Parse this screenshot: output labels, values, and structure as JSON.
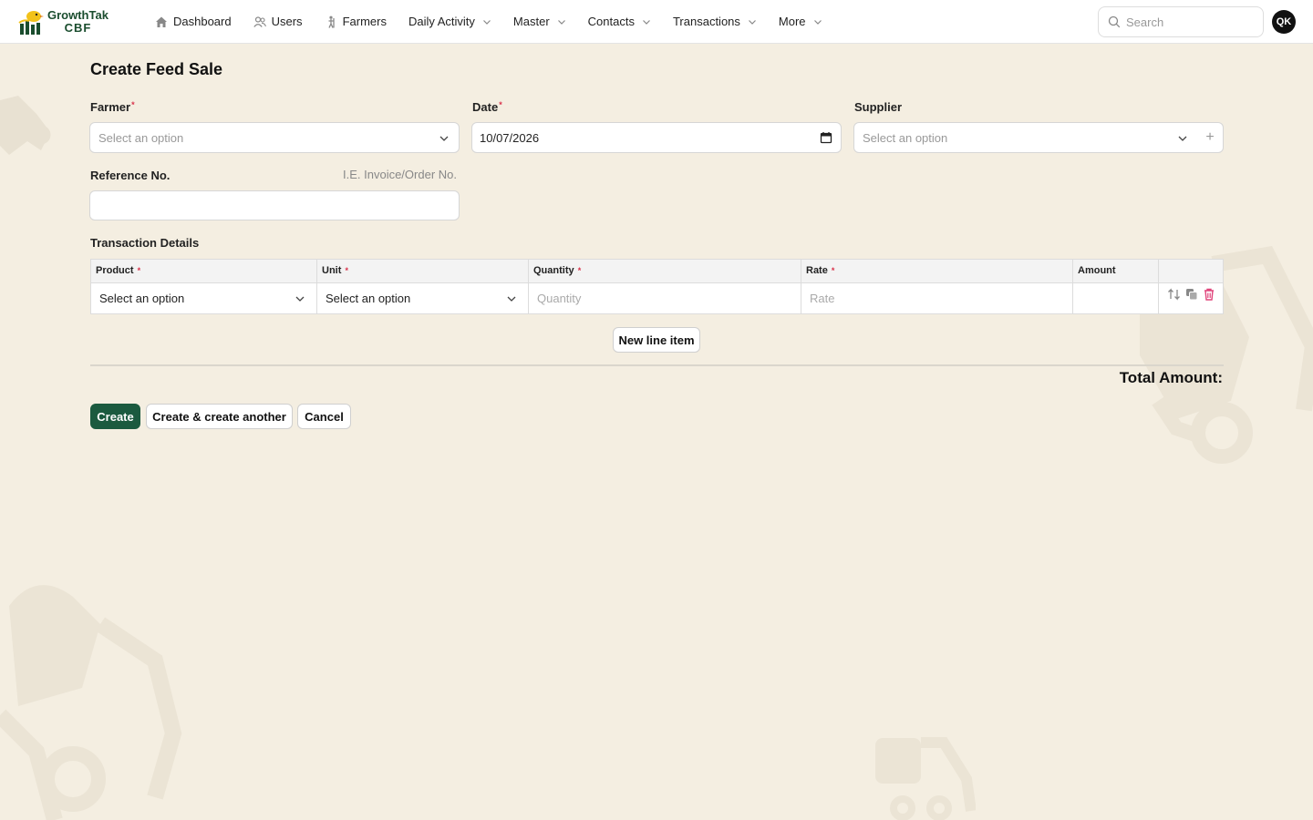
{
  "brand": {
    "name": "GrowthTak",
    "sub": "CBF"
  },
  "nav": {
    "items": [
      {
        "label": "Dashboard",
        "icon": "home-icon",
        "dropdown": false
      },
      {
        "label": "Users",
        "icon": "users-icon",
        "dropdown": false
      },
      {
        "label": "Farmers",
        "icon": "farmer-icon",
        "dropdown": false
      },
      {
        "label": "Daily Activity",
        "icon": "",
        "dropdown": true
      },
      {
        "label": "Master",
        "icon": "",
        "dropdown": true
      },
      {
        "label": "Contacts",
        "icon": "",
        "dropdown": true
      },
      {
        "label": "Transactions",
        "icon": "",
        "dropdown": true
      },
      {
        "label": "More",
        "icon": "",
        "dropdown": true
      }
    ],
    "search_placeholder": "Search",
    "avatar_initials": "QK"
  },
  "form": {
    "title": "Create Feed Sale",
    "farmer": {
      "label": "Farmer",
      "required_mark": "*",
      "placeholder": "Select an option"
    },
    "date": {
      "label": "Date",
      "required_mark": "*",
      "value": "10/07/2026"
    },
    "supplier": {
      "label": "Supplier",
      "placeholder": "Select an option",
      "add_label": "+"
    },
    "reference": {
      "label": "Reference No.",
      "hint": "I.E. Invoice/Order No.",
      "value": ""
    },
    "details": {
      "title": "Transaction Details",
      "columns": {
        "product": "Product",
        "unit": "Unit",
        "quantity": "Quantity",
        "rate": "Rate",
        "amount": "Amount",
        "req": "*"
      },
      "row": {
        "product": "Select an option",
        "unit": "Select an option",
        "quantity_placeholder": "Quantity",
        "rate_placeholder": "Rate",
        "amount": ""
      },
      "new_line_label": "New line item"
    },
    "total_label": "Total Amount:",
    "buttons": {
      "create": "Create",
      "create_another": "Create & create another",
      "cancel": "Cancel"
    }
  },
  "colors": {
    "background": "#f4eee1",
    "primary": "#1b5a3f",
    "delete": "#e0457b"
  }
}
